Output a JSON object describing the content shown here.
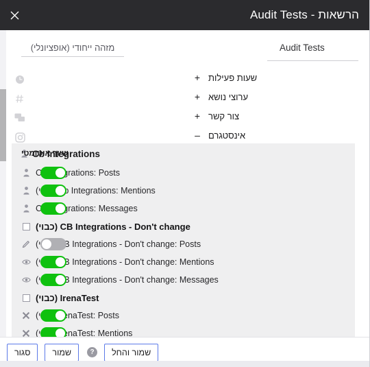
{
  "window": {
    "title": "הרשאות - Audit Tests",
    "close_icon": "close-icon"
  },
  "toolbar": {
    "tab_label": "Audit Tests",
    "uid_placeholder": "מזהה ייחודי (אופציונלי)",
    "uid_value": ""
  },
  "sidebar": {
    "icons": [
      {
        "name": "clock-icon"
      },
      {
        "name": "hash-icon"
      },
      {
        "name": "chat-icon"
      },
      {
        "name": "instagram-icon"
      }
    ]
  },
  "accordion": {
    "items": [
      {
        "label": "שעות פעילות",
        "sign": "+",
        "expanded": false
      },
      {
        "label": "ערוצי נושא",
        "sign": "+",
        "expanded": false
      },
      {
        "label": "צור קשר",
        "sign": "+",
        "expanded": false
      },
      {
        "label": "אינסטגרם",
        "sign": "–",
        "expanded": true
      }
    ]
  },
  "panel": {
    "auto_assign_label": "שיוך אוטומטי",
    "groups": [
      {
        "title": "Cb Integrations",
        "title_icon": "person-icon",
        "title_toggle": null,
        "rows": [
          {
            "label": "Cb Integrations: Posts",
            "icon": "person-icon",
            "toggle": "on"
          },
          {
            "label": "(כבוי) Cb Integrations: Mentions",
            "icon": "person-icon",
            "toggle": "on"
          },
          {
            "label": "Cb Integrations: Messages",
            "icon": "person-icon",
            "toggle": "on"
          }
        ]
      },
      {
        "title": "(כבוי) CB Integrations - Don't change",
        "title_icon": "checkbox-unchecked-icon",
        "rows": [
          {
            "label": "(כבוי) CB Integrations - Don't change: Posts",
            "icon": "pencil-icon",
            "toggle": "off"
          },
          {
            "label": "(כבוי) CB Integrations - Don't change: Mentions",
            "icon": "eye-icon",
            "toggle": "on"
          },
          {
            "label": "(כבוי) CB Integrations - Don't change: Messages",
            "icon": "eye-icon",
            "toggle": "on"
          }
        ]
      },
      {
        "title": "(כבוי) IrenaTest",
        "title_icon": "checkbox-unchecked-icon",
        "rows": [
          {
            "label": "(כבוי) IrenaTest: Posts",
            "icon": "x-icon",
            "toggle": "on"
          },
          {
            "label": "(כבוי) IrenaTest: Mentions",
            "icon": "x-icon",
            "toggle": "on"
          }
        ]
      }
    ]
  },
  "footer": {
    "close_label": "סגור",
    "save_label": "שמור",
    "help_label": "?",
    "save_apply_label": "שמור והחל"
  },
  "colors": {
    "titlebar_bg": "#2b2b2e",
    "toggle_on": "#0fc10f",
    "toggle_off": "#b0b0b4",
    "button_border": "#5b79e8",
    "panel_bg": "#efeff0"
  }
}
